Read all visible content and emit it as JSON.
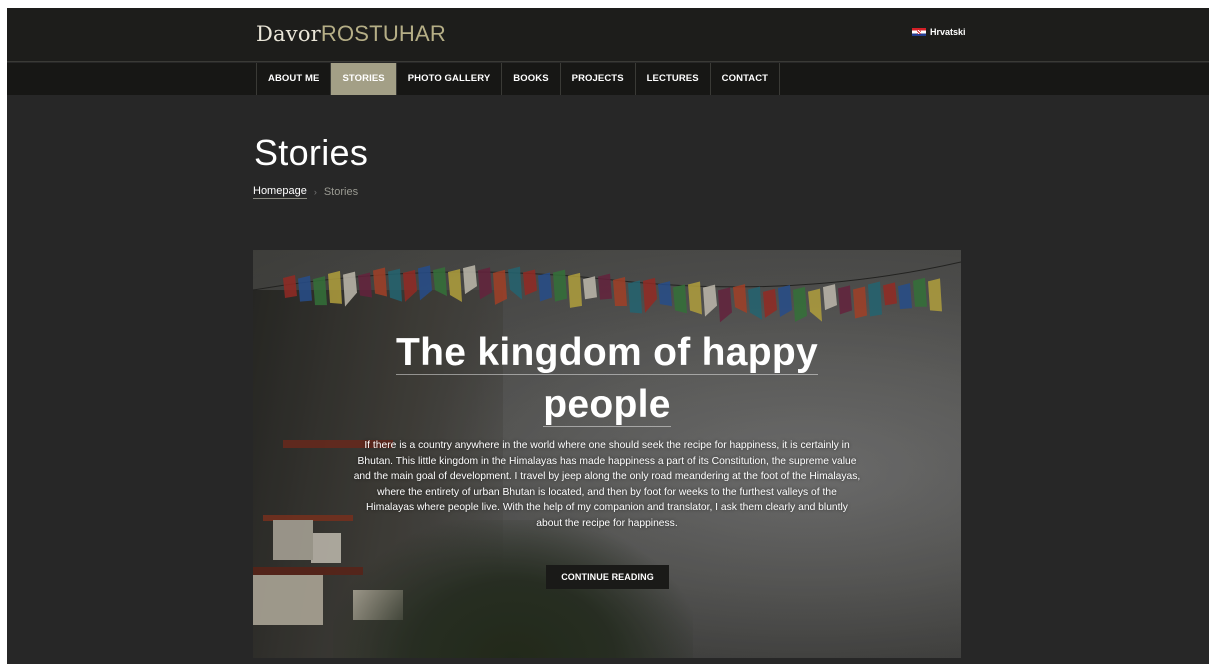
{
  "header": {
    "logo_first": "Davor",
    "logo_last": "ROSTUHAR",
    "language_label": "Hrvatski",
    "language_icon": "croatian-flag-icon"
  },
  "nav": {
    "items": [
      {
        "label": "ABOUT ME",
        "active": false
      },
      {
        "label": "STORIES",
        "active": true
      },
      {
        "label": "PHOTO GALLERY",
        "active": false
      },
      {
        "label": "BOOKS",
        "active": false
      },
      {
        "label": "PROJECTS",
        "active": false
      },
      {
        "label": "LECTURES",
        "active": false
      },
      {
        "label": "CONTACT",
        "active": false
      }
    ]
  },
  "page": {
    "title": "Stories",
    "breadcrumb": {
      "home": "Homepage",
      "separator": "›",
      "current": "Stories"
    }
  },
  "story": {
    "title_line1": "The kingdom of happy",
    "title_line2": "people",
    "excerpt": "If there is a country anywhere in the world where one should seek the recipe for happiness, it is certainly in Bhutan. This little kingdom in the Himalayas has made happiness a part of its Constitution, the supreme value and the main goal of development. I travel by jeep along the only road meandering at the foot of the Himalayas, where the entirety of urban Bhutan is located, and then by foot for weeks to the furthest valleys of the Himalayas where people live. With the help of my companion and translator, I ask them clearly and bluntly about the recipe for happiness.",
    "button_label": "CONTINUE READING"
  },
  "colors": {
    "page_bg": "#272727",
    "header_bg": "#1d1d1b",
    "nav_bg": "#171715",
    "nav_active": "#a39f86",
    "logo_accent": "#b5ae86"
  }
}
